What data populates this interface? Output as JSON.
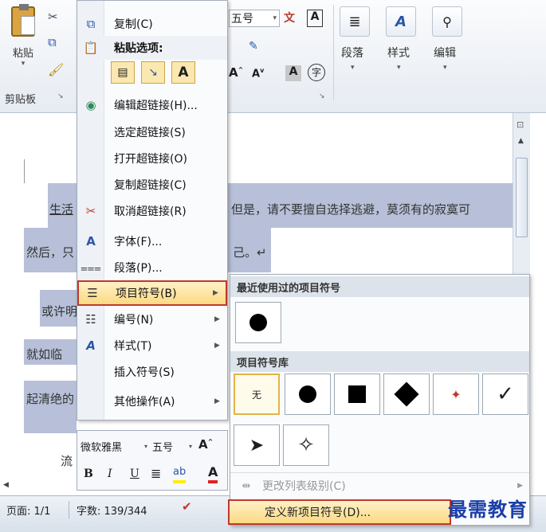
{
  "ribbon": {
    "paste_label": "粘贴",
    "clipboard_label": "剪贴板",
    "font_size": "五号",
    "wen_glyph": "wén",
    "paragraph_label": "段落",
    "style_label": "样式",
    "edit_label": "编辑"
  },
  "context_menu": {
    "items": [
      {
        "label": "复制(C)"
      },
      {
        "label": "粘贴选项:"
      },
      {
        "label": "编辑超链接(H)..."
      },
      {
        "label": "选定超链接(S)"
      },
      {
        "label": "打开超链接(O)"
      },
      {
        "label": "复制超链接(C)"
      },
      {
        "label": "取消超链接(R)"
      },
      {
        "label": "字体(F)..."
      },
      {
        "label": "段落(P)..."
      },
      {
        "label": "项目符号(B)"
      },
      {
        "label": "编号(N)"
      },
      {
        "label": "样式(T)"
      },
      {
        "label": "插入符号(S)"
      },
      {
        "label": "其他操作(A)"
      }
    ]
  },
  "submenu": {
    "recent_header": "最近使用过的项目符号",
    "library_header": "项目符号库",
    "none_label": "无",
    "change_level": "更改列表级别(C)",
    "define_new": "定义新项目符号(D)..."
  },
  "mini_toolbar": {
    "font": "微软雅黑",
    "size": "五号"
  },
  "document": {
    "line1_start": "生活",
    "line1_end": "但是，请不要擅自选择逃避，莫须有的寂寞可",
    "line2_start": "然后，只",
    "line2_end": "己。↵",
    "line3": "或许明",
    "line4": "就如临",
    "line5": "起清绝的",
    "line6": "流"
  },
  "status": {
    "page": "页面: 1/1",
    "words": "字数: 139/344"
  },
  "watermark": "最需教育"
}
